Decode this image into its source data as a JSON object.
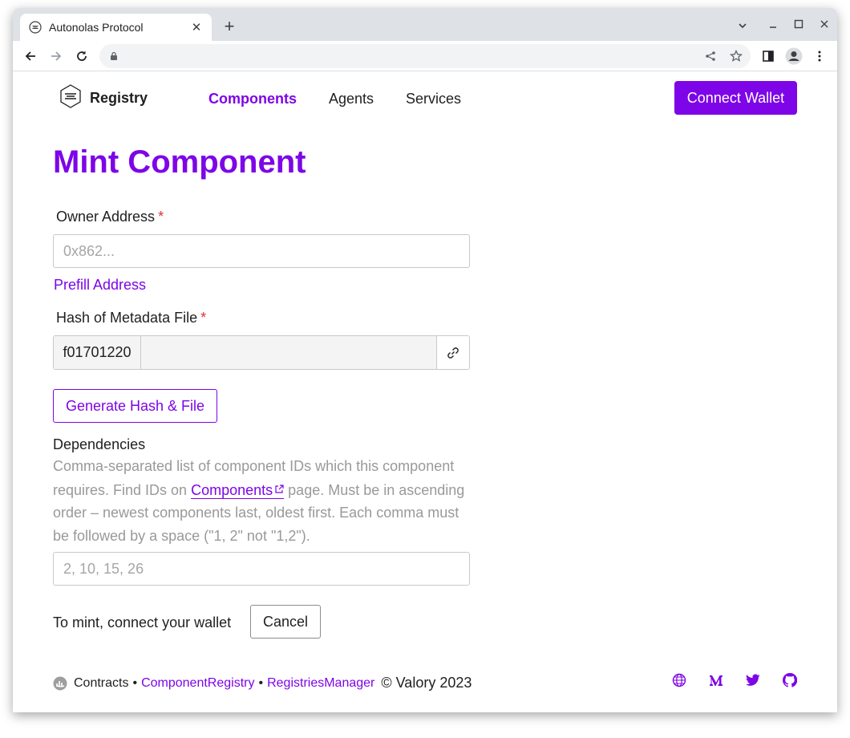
{
  "browser": {
    "tab_title": "Autonolas Protocol",
    "tab_close": "✕",
    "new_tab": "+",
    "address": "",
    "icons": [
      "favicon-icon",
      "back-icon",
      "forward-icon",
      "reload-icon",
      "lock-icon",
      "share-icon",
      "star-icon",
      "side-panel-icon",
      "profile-icon",
      "menu-icon",
      "chevron-down-icon",
      "minimize-icon",
      "maximize-icon",
      "close-icon"
    ]
  },
  "nav": {
    "brand": "Registry",
    "links": [
      "Components",
      "Agents",
      "Services"
    ],
    "active_link": "Components",
    "connect_label": "Connect Wallet"
  },
  "form": {
    "title": "Mint Component",
    "owner_label": "Owner Address",
    "required_mark": "*",
    "owner_placeholder": "0x862...",
    "prefill_label": "Prefill Address",
    "hash_label": "Hash of Metadata File",
    "hash_prefix": "f01701220",
    "hash_value": "",
    "generate_label": "Generate Hash & File",
    "dependencies_label": "Dependencies",
    "dependencies_help_1": "Comma-separated list of component IDs which this component requires. Find IDs on",
    "dependencies_help_link": "Components",
    "dependencies_help_2": "page. Must be in ascending order – newest components last, oldest first. Each comma must be followed by a space (\"1, 2\" not \"1,2\").",
    "dependencies_placeholder": "2, 10, 15, 26",
    "mint_message": "To mint, connect your wallet",
    "cancel_label": "Cancel"
  },
  "footer": {
    "contracts_label": "Contracts",
    "bullet": "•",
    "links": [
      "ComponentRegistry",
      "RegistriesManager"
    ],
    "copyright": "© Valory 2023",
    "social_icons": [
      "globe-icon",
      "medium-icon",
      "twitter-icon",
      "github-icon"
    ]
  },
  "colors": {
    "accent": "#7d05e7",
    "required": "#e03131",
    "muted": "#999999"
  }
}
